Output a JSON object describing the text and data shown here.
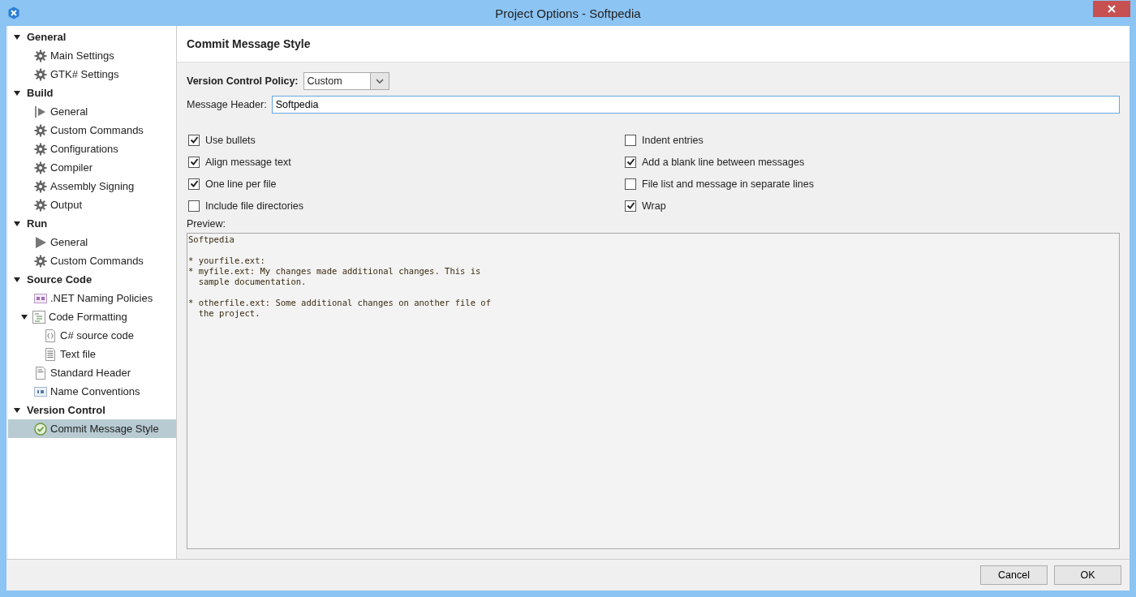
{
  "window": {
    "title": "Project Options - Softpedia"
  },
  "sidebar": {
    "groups": [
      {
        "label": "General",
        "expanded": true,
        "items": [
          {
            "label": "Main Settings",
            "kind": "gear",
            "selected": false
          },
          {
            "label": "GTK# Settings",
            "kind": "gear",
            "selected": false
          }
        ]
      },
      {
        "label": "Build",
        "expanded": true,
        "items": [
          {
            "label": "General",
            "kind": "build",
            "selected": false
          },
          {
            "label": "Custom Commands",
            "kind": "gear",
            "selected": false
          },
          {
            "label": "Configurations",
            "kind": "gear",
            "selected": false
          },
          {
            "label": "Compiler",
            "kind": "gear",
            "selected": false
          },
          {
            "label": "Assembly Signing",
            "kind": "gear",
            "selected": false
          },
          {
            "label": "Output",
            "kind": "gear",
            "selected": false
          }
        ]
      },
      {
        "label": "Run",
        "expanded": true,
        "items": [
          {
            "label": "General",
            "kind": "play",
            "selected": false
          },
          {
            "label": "Custom Commands",
            "kind": "gear",
            "selected": false
          }
        ]
      },
      {
        "label": "Source Code",
        "expanded": true,
        "items": [
          {
            "label": ".NET Naming Policies",
            "kind": "naming",
            "selected": false
          },
          {
            "label": "Code Formatting",
            "kind": "formatting",
            "selected": false,
            "expanded": true,
            "children": [
              {
                "label": "C# source code",
                "kind": "braces",
                "selected": false
              },
              {
                "label": "Text file",
                "kind": "text",
                "selected": false
              }
            ]
          },
          {
            "label": "Standard Header",
            "kind": "header",
            "selected": false
          },
          {
            "label": "Name Conventions",
            "kind": "conventions",
            "selected": false
          }
        ]
      },
      {
        "label": "Version Control",
        "expanded": true,
        "items": [
          {
            "label": "Commit Message Style",
            "kind": "check",
            "selected": true
          }
        ]
      }
    ]
  },
  "panel": {
    "title": "Commit Message Style",
    "policy_label": "Version Control Policy:",
    "policy_value": "Custom",
    "header_label": "Message Header:",
    "header_value": "Softpedia",
    "left_options": [
      {
        "label": "Use bullets",
        "checked": true
      },
      {
        "label": "Align message text",
        "checked": true
      },
      {
        "label": "One line per file",
        "checked": true
      },
      {
        "label": "Include file directories",
        "checked": false
      }
    ],
    "right_options": [
      {
        "label": "Indent entries",
        "checked": false
      },
      {
        "label": "Add a blank line between messages",
        "checked": true
      },
      {
        "label": "File list and message in separate lines",
        "checked": false
      },
      {
        "label": "Wrap",
        "checked": true
      }
    ],
    "preview_label": "Preview:",
    "preview_blocks": [
      "Softpedia",
      "* yourfile.ext:\n* myfile.ext: My changes made additional changes. This is\n  sample documentation.",
      "* otherfile.ext: Some additional changes on another file of\n  the project."
    ]
  },
  "buttons": [
    "Cancel",
    "OK"
  ]
}
